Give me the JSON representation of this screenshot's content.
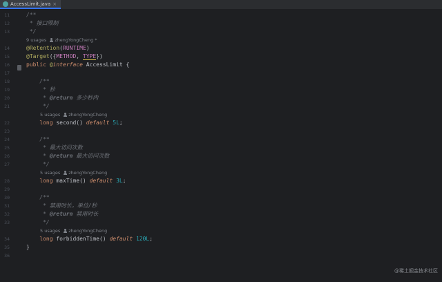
{
  "tab": {
    "file_icon": "java-interface-icon",
    "label": "AccessLimit.java",
    "close": "×"
  },
  "lines": [
    {
      "n": "11",
      "parts": [
        {
          "c": "comment",
          "t": "/**"
        }
      ]
    },
    {
      "n": "12",
      "parts": [
        {
          "c": "comment",
          "t": " * 接口限制"
        }
      ]
    },
    {
      "n": "13",
      "parts": [
        {
          "c": "comment",
          "t": " */"
        }
      ]
    },
    {
      "hint": true,
      "usages": "9 usages",
      "author": "zhengYongCheng *"
    },
    {
      "n": "14",
      "parts": [
        {
          "c": "anno",
          "t": "@Retention"
        },
        {
          "c": "punc",
          "t": "("
        },
        {
          "c": "const",
          "t": "RUNTIME"
        },
        {
          "c": "punc",
          "t": ")"
        }
      ]
    },
    {
      "n": "15",
      "parts": [
        {
          "c": "anno",
          "t": "@Target"
        },
        {
          "c": "punc",
          "t": "({"
        },
        {
          "c": "const",
          "t": "METHOD"
        },
        {
          "c": "punc",
          "t": ", "
        },
        {
          "c": "const underline-yellow",
          "t": "TYPE"
        },
        {
          "c": "punc",
          "t": "})"
        }
      ]
    },
    {
      "n": "16",
      "parts": [
        {
          "c": "kw",
          "t": "public "
        },
        {
          "c": "anno",
          "t": "@"
        },
        {
          "c": "kwi",
          "t": "interface "
        },
        {
          "c": "ident",
          "t": "AccessLimit "
        },
        {
          "c": "punc",
          "t": "{"
        }
      ]
    },
    {
      "n": "17",
      "parts": []
    },
    {
      "n": "18",
      "parts": [
        {
          "c": "comment",
          "t": "    /**"
        }
      ]
    },
    {
      "n": "19",
      "parts": [
        {
          "c": "comment",
          "t": "     * 秒"
        }
      ]
    },
    {
      "n": "20",
      "parts": [
        {
          "c": "comment",
          "t": "     * "
        },
        {
          "c": "tag",
          "t": "@return"
        },
        {
          "c": "comment",
          "t": " 多少秒内"
        }
      ]
    },
    {
      "n": "21",
      "parts": [
        {
          "c": "comment",
          "t": "     */"
        }
      ]
    },
    {
      "hint": true,
      "indent": true,
      "usages": "5 usages",
      "author": "zhengYongCheng"
    },
    {
      "n": "22",
      "parts": [
        {
          "c": "kw",
          "t": "    long "
        },
        {
          "c": "ident",
          "t": "second"
        },
        {
          "c": "punc",
          "t": "() "
        },
        {
          "c": "kwi",
          "t": "default "
        },
        {
          "c": "num",
          "t": "5L"
        },
        {
          "c": "punc",
          "t": ";"
        }
      ]
    },
    {
      "n": "23",
      "parts": []
    },
    {
      "n": "24",
      "parts": [
        {
          "c": "comment",
          "t": "    /**"
        }
      ]
    },
    {
      "n": "25",
      "parts": [
        {
          "c": "comment",
          "t": "     * 最大访问次数"
        }
      ]
    },
    {
      "n": "26",
      "parts": [
        {
          "c": "comment",
          "t": "     * "
        },
        {
          "c": "tag",
          "t": "@return"
        },
        {
          "c": "comment",
          "t": " 最大访问次数"
        }
      ]
    },
    {
      "n": "27",
      "parts": [
        {
          "c": "comment",
          "t": "     */"
        }
      ]
    },
    {
      "hint": true,
      "indent": true,
      "usages": "5 usages",
      "author": "zhengYongCheng"
    },
    {
      "n": "28",
      "parts": [
        {
          "c": "kw",
          "t": "    long "
        },
        {
          "c": "ident",
          "t": "maxTime"
        },
        {
          "c": "punc",
          "t": "() "
        },
        {
          "c": "kwi",
          "t": "default "
        },
        {
          "c": "num",
          "t": "3L"
        },
        {
          "c": "punc",
          "t": ";"
        }
      ]
    },
    {
      "n": "29",
      "parts": []
    },
    {
      "n": "30",
      "parts": [
        {
          "c": "comment",
          "t": "    /**"
        }
      ]
    },
    {
      "n": "31",
      "parts": [
        {
          "c": "comment",
          "t": "     * 禁用时长，单位/秒"
        }
      ]
    },
    {
      "n": "32",
      "parts": [
        {
          "c": "comment",
          "t": "     * "
        },
        {
          "c": "tag",
          "t": "@return"
        },
        {
          "c": "comment",
          "t": " 禁用时长"
        }
      ]
    },
    {
      "n": "33",
      "parts": [
        {
          "c": "comment",
          "t": "     */"
        }
      ]
    },
    {
      "hint": true,
      "indent": true,
      "usages": "5 usages",
      "author": "zhengYongCheng"
    },
    {
      "n": "34",
      "parts": [
        {
          "c": "kw",
          "t": "    long "
        },
        {
          "c": "ident",
          "t": "forbiddenTime"
        },
        {
          "c": "punc",
          "t": "() "
        },
        {
          "c": "kwi",
          "t": "default "
        },
        {
          "c": "num",
          "t": "120L"
        },
        {
          "c": "punc",
          "t": ";"
        }
      ]
    },
    {
      "n": "35",
      "parts": [
        {
          "c": "punc",
          "t": "}"
        }
      ]
    },
    {
      "n": "36",
      "parts": []
    }
  ],
  "watermark": "@稀土掘金技术社区"
}
